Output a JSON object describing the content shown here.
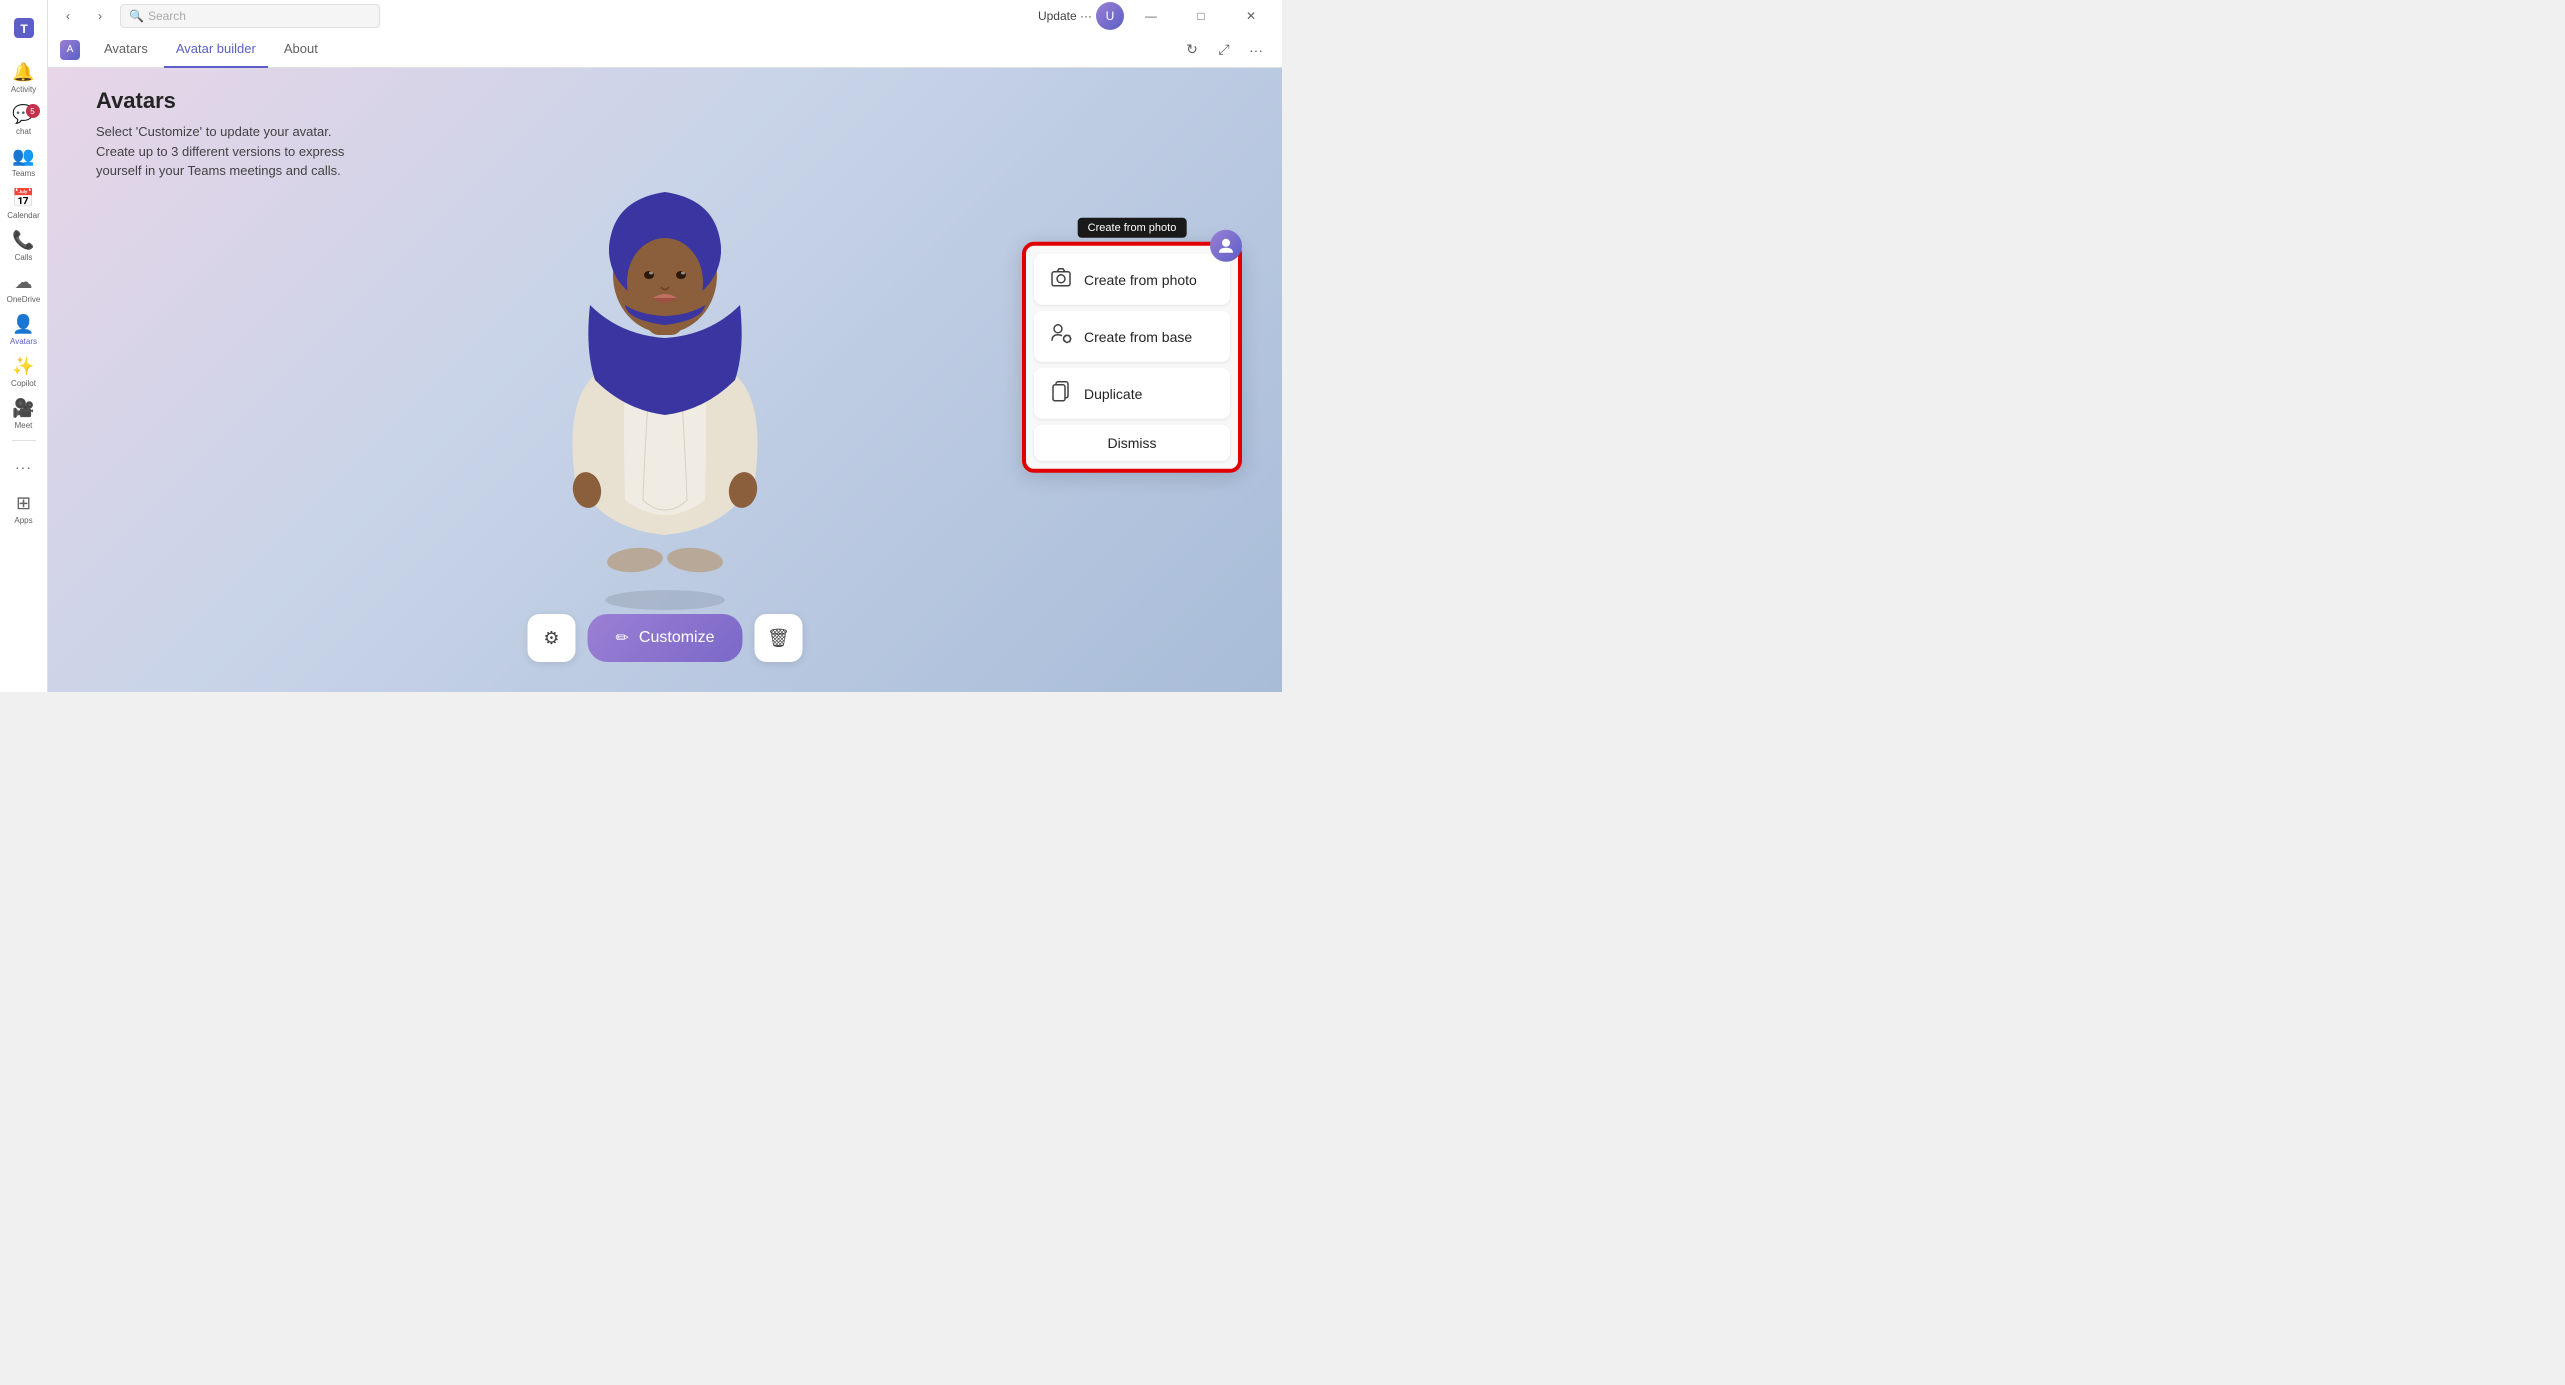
{
  "app": {
    "title": "Microsoft Teams"
  },
  "titlebar": {
    "back_label": "‹",
    "forward_label": "›",
    "search_placeholder": "Search",
    "update_label": "Update ···",
    "minimize_label": "—",
    "maximize_label": "□",
    "close_label": "✕"
  },
  "tabbar": {
    "app_name": "Avatars",
    "tabs": [
      {
        "id": "avatars",
        "label": "Avatars"
      },
      {
        "id": "avatar-builder",
        "label": "Avatar builder"
      },
      {
        "id": "about",
        "label": "About"
      }
    ],
    "active_tab": "avatar-builder"
  },
  "sidebar": {
    "items": [
      {
        "id": "activity",
        "label": "Activity",
        "icon": "🔔",
        "badge": null
      },
      {
        "id": "chat",
        "label": "Chat",
        "icon": "💬",
        "badge": "5"
      },
      {
        "id": "teams",
        "label": "Teams",
        "icon": "👥",
        "badge": null
      },
      {
        "id": "calendar",
        "label": "Calendar",
        "icon": "📅",
        "badge": null
      },
      {
        "id": "calls",
        "label": "Calls",
        "icon": "📞",
        "badge": null
      },
      {
        "id": "onedrive",
        "label": "OneDrive",
        "icon": "☁",
        "badge": null
      },
      {
        "id": "avatars",
        "label": "Avatars",
        "icon": "👤",
        "badge": null
      },
      {
        "id": "copilot",
        "label": "Copilot",
        "icon": "✨",
        "badge": null
      },
      {
        "id": "meet",
        "label": "Meet",
        "icon": "🎥",
        "badge": null
      },
      {
        "id": "more",
        "label": "···",
        "icon": "···",
        "badge": null
      },
      {
        "id": "apps",
        "label": "Apps",
        "icon": "⊞",
        "badge": null
      }
    ]
  },
  "page": {
    "title": "Avatars",
    "description_line1": "Select 'Customize' to update your avatar.",
    "description_line2": "Create up to 3 different versions to express",
    "description_line3": "yourself in your Teams meetings and calls."
  },
  "bottom_toolbar": {
    "settings_icon": "⚙",
    "customize_label": "Customize",
    "customize_icon": "✏",
    "delete_icon": "🗑"
  },
  "dropdown": {
    "tooltip_label": "Create from photo",
    "items": [
      {
        "id": "create-from-photo",
        "label": "Create from photo",
        "icon": "📷"
      },
      {
        "id": "create-from-base",
        "label": "Create from base",
        "icon": "👤"
      },
      {
        "id": "duplicate",
        "label": "Duplicate",
        "icon": "📋"
      },
      {
        "id": "dismiss",
        "label": "Dismiss",
        "icon": null
      }
    ]
  }
}
